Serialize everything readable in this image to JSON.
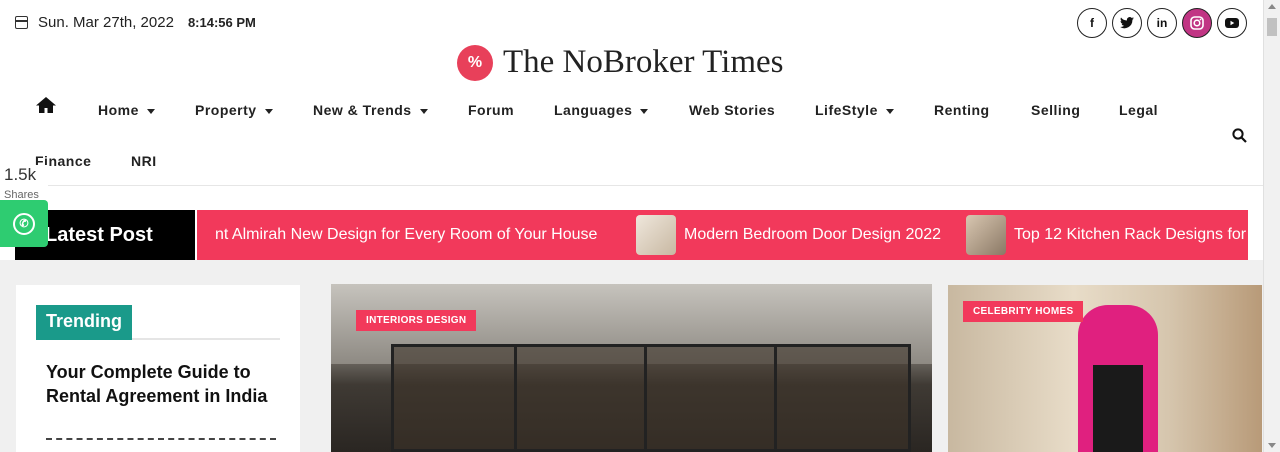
{
  "header": {
    "date": "Sun. Mar 27th, 2022",
    "time": "8:14:56 PM",
    "site_title": "The NoBroker Times",
    "logo_glyph": "%",
    "social": [
      "f",
      "t",
      "in",
      "ig",
      "yt"
    ]
  },
  "nav": {
    "items": [
      {
        "label": "Home",
        "has_dropdown": true
      },
      {
        "label": "Property",
        "has_dropdown": true
      },
      {
        "label": "New & Trends",
        "has_dropdown": true
      },
      {
        "label": "Forum",
        "has_dropdown": false
      },
      {
        "label": "Languages",
        "has_dropdown": true
      },
      {
        "label": "Web Stories",
        "has_dropdown": false
      },
      {
        "label": "LifeStyle",
        "has_dropdown": true
      },
      {
        "label": "Renting",
        "has_dropdown": false
      },
      {
        "label": "Selling",
        "has_dropdown": false
      },
      {
        "label": "Legal",
        "has_dropdown": false
      },
      {
        "label": "Finance",
        "has_dropdown": false
      },
      {
        "label": "NRI",
        "has_dropdown": false
      }
    ]
  },
  "share": {
    "count": "1.5k",
    "label": "Shares"
  },
  "latest": {
    "label": "Latest Post",
    "items": [
      "nt Almirah New Design for Every Room of Your House",
      "Modern Bedroom Door Design 2022",
      "Top 12 Kitchen Rack Designs for"
    ]
  },
  "trending": {
    "label": "Trending",
    "title": "Your Complete Guide to Rental Agreement in India"
  },
  "featured": {
    "main_category": "INTERIORS DESIGN",
    "side_category": "CELEBRITY HOMES"
  },
  "colors": {
    "accent": "#f2395b",
    "trending": "#1a9a8a",
    "whatsapp": "#2ecc71"
  }
}
